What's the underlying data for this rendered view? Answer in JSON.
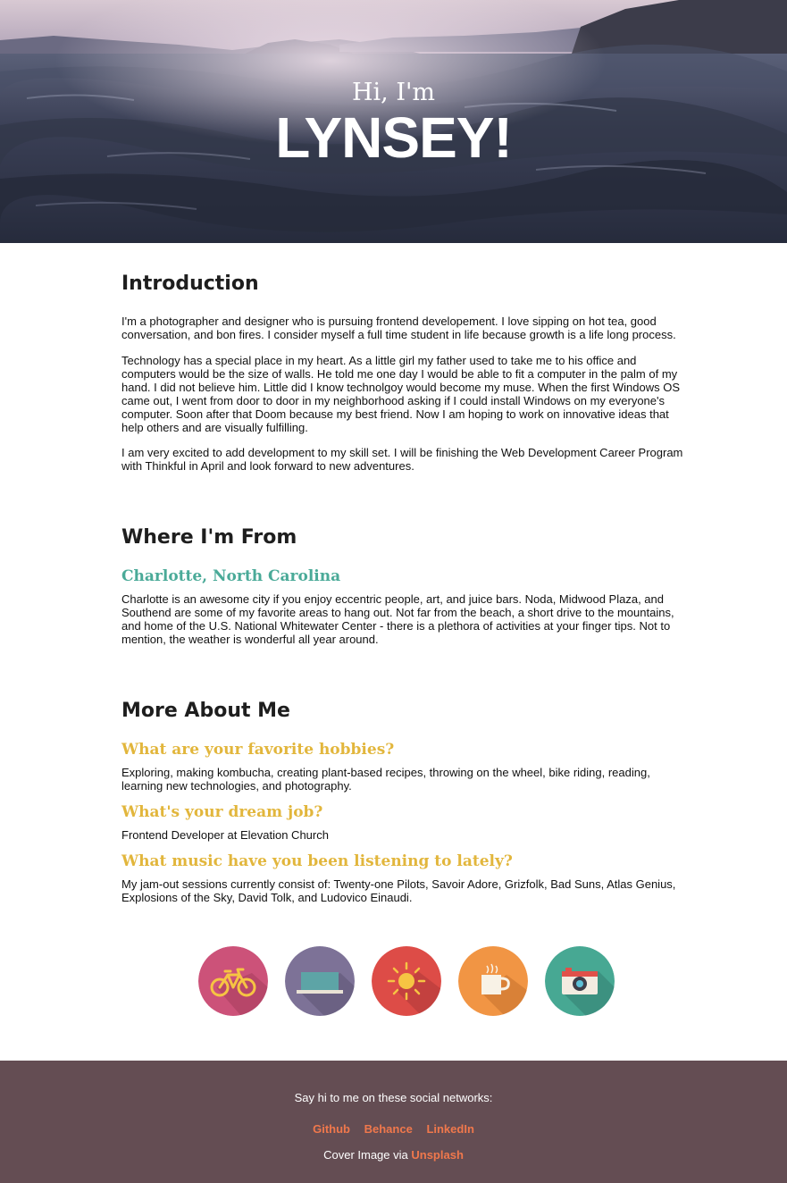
{
  "hero": {
    "greeting": "Hi, I'm",
    "name": "LYNSEY!"
  },
  "intro": {
    "title": "Introduction",
    "paragraphs": [
      "I'm a photographer and designer who is pursuing frontend developement. I love sipping on hot tea, good conversation, and bon fires. I consider myself a full time student in life because growth is a life long process.",
      "Technology has a special place in my heart. As a little girl my father used to take me to his office and computers would be the size of walls. He told me one day I would be able to fit a computer in the palm of my hand. I did not believe him. Little did I know technolgoy would become my muse. When the first Windows OS came out, I went from door to door in my neighborhood asking if I could install Windows on my everyone's computer. Soon after that Doom because my best friend. Now I am hoping to work on innovative ideas that help others and are visually fulfilling.",
      "I am very excited to add development to my skill set. I will be finishing the Web Development Career Program with Thinkful in April and look forward to new adventures."
    ]
  },
  "from": {
    "title": "Where I'm From",
    "place": "Charlotte, North Carolina",
    "text": "Charlotte is an awesome city if you enjoy eccentric people, art, and juice bars. Noda, Midwood Plaza, and Southend are some of my favorite areas to hang out. Not far from the beach, a short drive to the mountains, and home of the U.S. National Whitewater Center - there is a plethora of activities at your finger tips. Not to mention, the weather is wonderful all year around."
  },
  "more": {
    "title": "More About Me",
    "qa": [
      {
        "q": "What are your favorite hobbies?",
        "a": "Exploring, making kombucha, creating plant-based recipes, throwing on the wheel, bike riding, reading, learning new technologies, and photography."
      },
      {
        "q": "What's your dream job?",
        "a": "Frontend Developer at Elevation Church"
      },
      {
        "q": "What music have you been listening to lately?",
        "a": "My jam-out sessions currently consist of: Twenty-one Pilots, Savoir Adore, Grizfolk, Bad Suns, Atlas Genius, Explosions of the Sky, David Tolk, and Ludovico Einaudi."
      }
    ]
  },
  "icons": [
    {
      "name": "bicycle-icon",
      "color": "#cc5279"
    },
    {
      "name": "laptop-icon",
      "color": "#7d7297"
    },
    {
      "name": "sun-icon",
      "color": "#dd4c47"
    },
    {
      "name": "coffee-cup-icon",
      "color": "#f19544"
    },
    {
      "name": "camera-icon",
      "color": "#47a893"
    }
  ],
  "footer": {
    "say": "Say hi to me on these social networks:",
    "links": [
      "Github",
      "Behance",
      "LinkedIn"
    ],
    "cover_prefix": "Cover Image via",
    "cover_link": "Unsplash",
    "bg_color": "#644d53",
    "link_color": "#f0784c"
  }
}
